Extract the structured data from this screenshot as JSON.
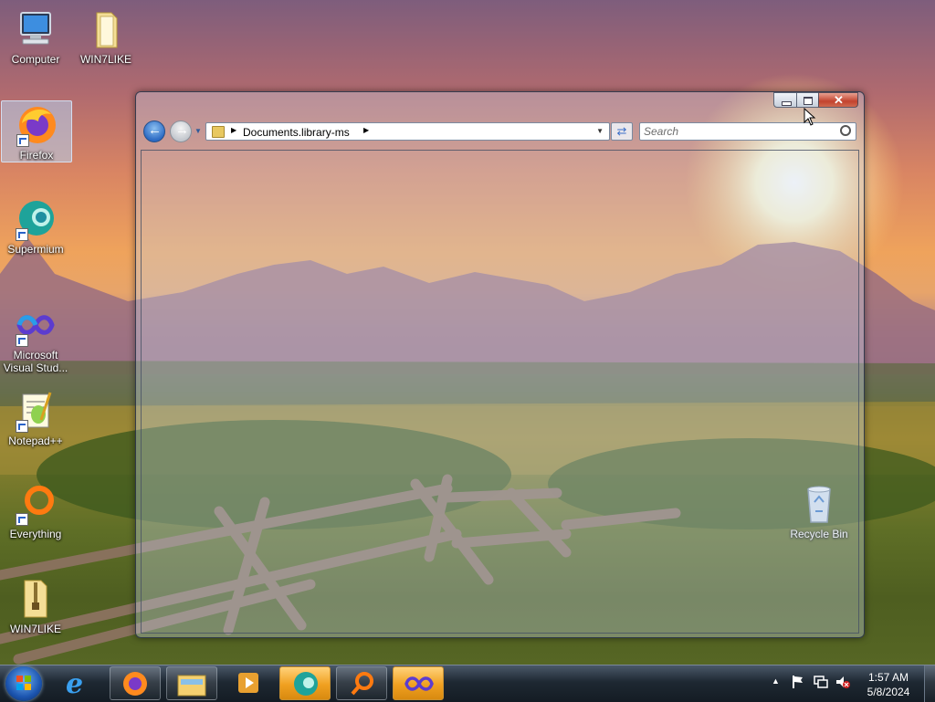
{
  "desktop": {
    "icons": [
      {
        "label": "Computer"
      },
      {
        "label": "WIN7LIKE"
      },
      {
        "label": "Firefox"
      },
      {
        "label": "Supermium"
      },
      {
        "label": "Microsoft Visual Stud..."
      },
      {
        "label": "Notepad++"
      },
      {
        "label": "Everything"
      },
      {
        "label": "WIN7LIKE"
      },
      {
        "label": "Recycle Bin"
      }
    ],
    "selected_icon": "Firefox"
  },
  "explorer": {
    "address": "Documents.library-ms",
    "search_placeholder": "Search",
    "caption_buttons": {
      "minimize": "minimize-icon",
      "maximize": "maximize-icon",
      "close": "close-icon"
    }
  },
  "taskbar": {
    "start_icon": "windows-orb-icon",
    "items": [
      {
        "name": "Internet Explorer",
        "icon": "ie-icon",
        "state": "pinned"
      },
      {
        "name": "Firefox",
        "icon": "firefox-icon",
        "state": "running"
      },
      {
        "name": "Windows Explorer",
        "icon": "folder-icon",
        "state": "running"
      },
      {
        "name": "Media Player",
        "icon": "media-player-icon",
        "state": "pinned"
      },
      {
        "name": "Supermium",
        "icon": "supermium-icon",
        "state": "active"
      },
      {
        "name": "Everything",
        "icon": "everything-search-icon",
        "state": "running"
      },
      {
        "name": "Visual Studio",
        "icon": "visual-studio-icon",
        "state": "active"
      }
    ],
    "tray": {
      "icons": [
        "show-hidden-icons",
        "action-center-flag-icon",
        "network-icon",
        "volume-muted-icon"
      ],
      "time": "1:57 AM",
      "date": "5/8/2024"
    }
  },
  "colors": {
    "taskbar_active": "#f0a020",
    "close_button": "#c3432e",
    "accent_blue": "#2d6bc4"
  }
}
